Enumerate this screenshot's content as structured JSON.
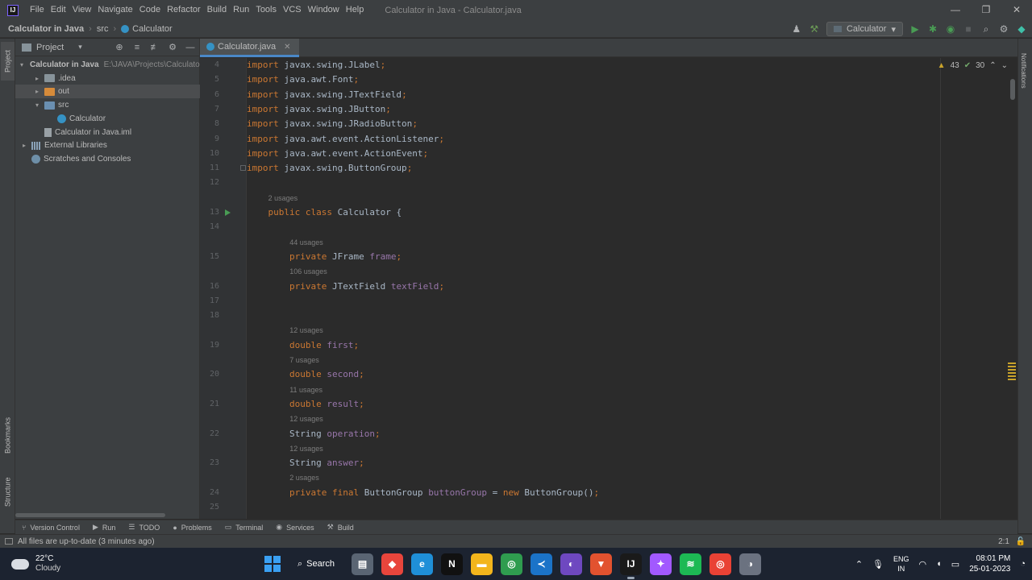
{
  "app": {
    "logo": "IJ",
    "menu": [
      "File",
      "Edit",
      "View",
      "Navigate",
      "Code",
      "Refactor",
      "Build",
      "Run",
      "Tools",
      "VCS",
      "Window",
      "Help"
    ],
    "window_title": "Calculator in Java - Calculator.java",
    "window_controls": {
      "minimize": "—",
      "restore": "❐",
      "close": "✕"
    }
  },
  "breadcrumb": {
    "root": "Calculator in Java",
    "folder": "src",
    "file": "Calculator"
  },
  "nav_actions": {
    "run_config": "Calculator",
    "user_icon": "♟",
    "hammer_icon": "⚒",
    "run_icon": "▶",
    "debug_icon": "✱",
    "coverage_icon": "◉",
    "stop_icon": "■",
    "search_icon": "⌕",
    "gear_icon": "⚙",
    "jb_icon": "◆"
  },
  "left_stripe": {
    "project_tab": "Project",
    "bookmarks_tab": "Bookmarks",
    "structure_tab": "Structure"
  },
  "right_stripe": {
    "notifications_tab": "Notifications"
  },
  "project_panel": {
    "title": "Project",
    "dropdown": "▾",
    "tools": [
      "⊕",
      "≡",
      "≢",
      "⚙",
      "—"
    ],
    "tree": [
      {
        "label": "Calculator in Java",
        "hint": "E:\\JAVA\\Projects\\Calculator in Java",
        "icon": "folder-grey",
        "arrow": "▾",
        "depth": 0
      },
      {
        "label": ".idea",
        "icon": "folder-grey",
        "arrow": "▸",
        "depth": 1
      },
      {
        "label": "out",
        "icon": "folder-orange",
        "arrow": "▸",
        "depth": 1
      },
      {
        "label": "src",
        "icon": "folder-blue",
        "arrow": "▾",
        "depth": 1
      },
      {
        "label": "Calculator",
        "icon": "class",
        "arrow": "",
        "depth": 2
      },
      {
        "label": "Calculator in Java.iml",
        "icon": "file",
        "arrow": "",
        "depth": 1
      },
      {
        "label": "External Libraries",
        "icon": "library",
        "arrow": "▸",
        "depth": 0
      },
      {
        "label": "Scratches and Consoles",
        "icon": "scratch",
        "arrow": "",
        "depth": 0
      }
    ]
  },
  "editor": {
    "tab_label": "Calculator.java",
    "tab_close": "✕",
    "inspections": {
      "warnings": "43",
      "weak_warnings": "30",
      "up": "⌃",
      "down": "⌄"
    },
    "lines": [
      {
        "num": "4",
        "tokens": [
          [
            "kw",
            "import "
          ],
          [
            "",
            "javax.swing.JLabel"
          ],
          [
            "pun",
            ";"
          ]
        ]
      },
      {
        "num": "5",
        "tokens": [
          [
            "kw",
            "import "
          ],
          [
            "",
            "java.awt.Font"
          ],
          [
            "pun",
            ";"
          ]
        ]
      },
      {
        "num": "6",
        "tokens": [
          [
            "kw",
            "import "
          ],
          [
            "",
            "javax.swing.JTextField"
          ],
          [
            "pun",
            ";"
          ]
        ]
      },
      {
        "num": "7",
        "tokens": [
          [
            "kw",
            "import "
          ],
          [
            "",
            "javax.swing.JButton"
          ],
          [
            "pun",
            ";"
          ]
        ]
      },
      {
        "num": "8",
        "tokens": [
          [
            "kw",
            "import "
          ],
          [
            "",
            "javax.swing.JRadioButton"
          ],
          [
            "pun",
            ";"
          ]
        ]
      },
      {
        "num": "9",
        "tokens": [
          [
            "kw",
            "import "
          ],
          [
            "",
            "java.awt.event.ActionListener"
          ],
          [
            "pun",
            ";"
          ]
        ]
      },
      {
        "num": "10",
        "tokens": [
          [
            "kw",
            "import "
          ],
          [
            "",
            "java.awt.event.ActionEvent"
          ],
          [
            "pun",
            ";"
          ]
        ]
      },
      {
        "num": "11",
        "tokens": [
          [
            "kw",
            "import "
          ],
          [
            "",
            "javax.swing.ButtonGroup"
          ],
          [
            "pun",
            ";"
          ]
        ]
      },
      {
        "num": "12",
        "tokens": []
      },
      {
        "num": "13",
        "hint": "2 usages",
        "tokens": [
          [
            "",
            "    "
          ],
          [
            "kw",
            "public class "
          ],
          [
            "",
            "Calculator {"
          ]
        ]
      },
      {
        "num": "14",
        "tokens": []
      },
      {
        "num": "15",
        "hint": "44 usages",
        "tokens": [
          [
            "",
            "        "
          ],
          [
            "kw",
            "private "
          ],
          [
            "",
            "JFrame "
          ],
          [
            "fld",
            "frame"
          ],
          [
            "pun",
            ";"
          ]
        ]
      },
      {
        "num": "16",
        "hint": "106 usages",
        "tokens": [
          [
            "",
            "        "
          ],
          [
            "kw",
            "private "
          ],
          [
            "",
            "JTextField "
          ],
          [
            "fld",
            "textField"
          ],
          [
            "pun",
            ";"
          ]
        ]
      },
      {
        "num": "17",
        "tokens": []
      },
      {
        "num": "18",
        "tokens": []
      },
      {
        "num": "19",
        "hint": "12 usages",
        "tokens": [
          [
            "",
            "        "
          ],
          [
            "kw",
            "double "
          ],
          [
            "fld",
            "first"
          ],
          [
            "pun",
            ";"
          ]
        ]
      },
      {
        "num": "20",
        "hint": "7 usages",
        "tokens": [
          [
            "",
            "        "
          ],
          [
            "kw",
            "double "
          ],
          [
            "fld",
            "second"
          ],
          [
            "pun",
            ";"
          ]
        ]
      },
      {
        "num": "21",
        "hint": "11 usages",
        "tokens": [
          [
            "",
            "        "
          ],
          [
            "kw",
            "double "
          ],
          [
            "fld",
            "result"
          ],
          [
            "pun",
            ";"
          ]
        ]
      },
      {
        "num": "22",
        "hint": "12 usages",
        "tokens": [
          [
            "",
            "        "
          ],
          [
            "",
            "String "
          ],
          [
            "fld",
            "operation"
          ],
          [
            "pun",
            ";"
          ]
        ]
      },
      {
        "num": "23",
        "hint": "12 usages",
        "tokens": [
          [
            "",
            "        "
          ],
          [
            "",
            "String "
          ],
          [
            "fld",
            "answer"
          ],
          [
            "pun",
            ";"
          ]
        ]
      },
      {
        "num": "24",
        "hint": "2 usages",
        "tokens": [
          [
            "",
            "        "
          ],
          [
            "kw",
            "private final "
          ],
          [
            "",
            "ButtonGroup "
          ],
          [
            "fld",
            "buttonGroup"
          ],
          [
            "",
            " = "
          ],
          [
            "kw",
            "new "
          ],
          [
            "",
            "ButtonGroup()"
          ],
          [
            "pun",
            ";"
          ]
        ]
      },
      {
        "num": "25",
        "tokens": []
      }
    ]
  },
  "tool_windows": [
    {
      "label": "Version Control",
      "glyph": "⑂"
    },
    {
      "label": "Run",
      "glyph": "▶"
    },
    {
      "label": "TODO",
      "glyph": "☰"
    },
    {
      "label": "Problems",
      "glyph": "●"
    },
    {
      "label": "Terminal",
      "glyph": "▭"
    },
    {
      "label": "Services",
      "glyph": "◉"
    },
    {
      "label": "Build",
      "glyph": "⚒"
    }
  ],
  "status": {
    "message": "All files are up-to-date (3 minutes ago)",
    "caret": "2:1",
    "lock": "🔓"
  },
  "taskbar": {
    "temp": "22°C",
    "condition": "Cloudy",
    "search_label": "Search",
    "apps": [
      {
        "name": "file-manager-app",
        "glyph": "▤",
        "color": "#5a6573"
      },
      {
        "name": "git-app",
        "glyph": "◆",
        "color": "#e8453c"
      },
      {
        "name": "edge-app",
        "glyph": "e",
        "color": "#1f8fd8"
      },
      {
        "name": "notion-app",
        "glyph": "N",
        "color": "#111111"
      },
      {
        "name": "explorer-app",
        "glyph": "▬",
        "color": "#f3b51c"
      },
      {
        "name": "chrome-app",
        "glyph": "◎",
        "color": "#2f9c4f"
      },
      {
        "name": "vscode-app",
        "glyph": "≺",
        "color": "#1b73c8"
      },
      {
        "name": "github-app",
        "glyph": "◐",
        "color": "#6e48c0"
      },
      {
        "name": "brave-app",
        "glyph": "▼",
        "color": "#e2522f"
      },
      {
        "name": "intellij-app",
        "glyph": "IJ",
        "color": "#1a1a1a",
        "active": true
      },
      {
        "name": "figma-app",
        "glyph": "✦",
        "color": "#a259ff"
      },
      {
        "name": "spotify-app",
        "glyph": "≋",
        "color": "#1db954"
      },
      {
        "name": "chrome-dev-app",
        "glyph": "◎",
        "color": "#e94235"
      },
      {
        "name": "github-desktop-app",
        "glyph": "◑",
        "color": "#6b7280"
      }
    ],
    "tray_chevron": "⌃",
    "lang_line1": "ENG",
    "lang_line2": "IN",
    "time": "08:01 PM",
    "date": "25-01-2023"
  }
}
